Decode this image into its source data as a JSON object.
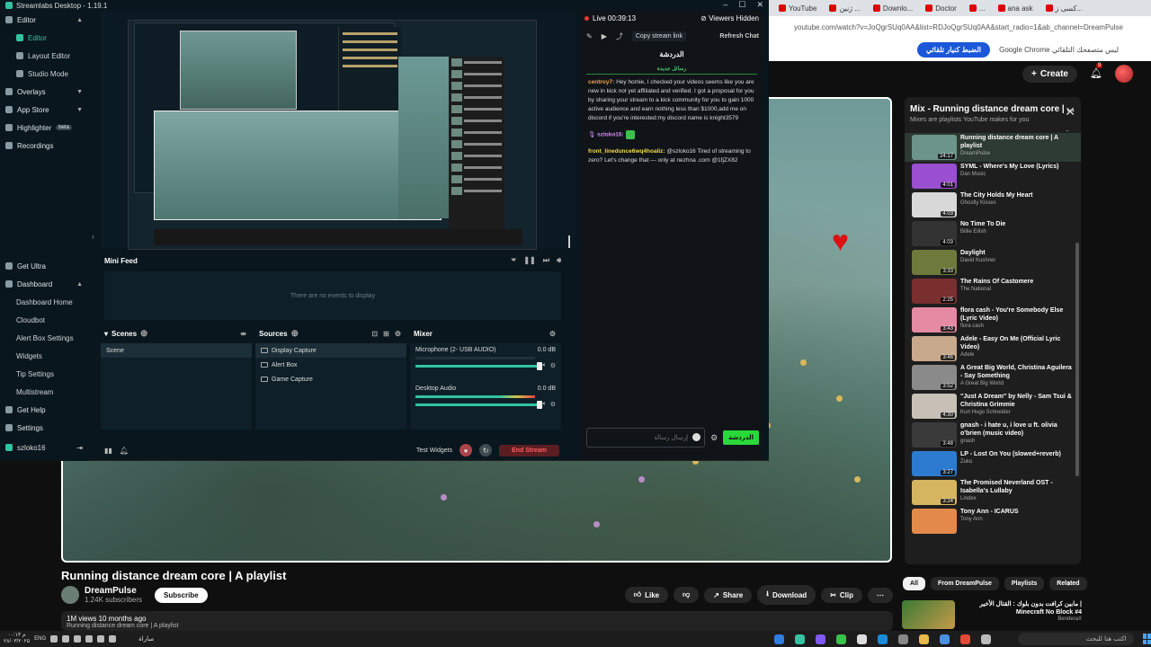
{
  "browser": {
    "tabs": [
      "YouTube",
      "ژنین ...",
      "Downlo...",
      "Doctor",
      "...",
      "ana ask",
      "کسی ز..."
    ],
    "url": "youtube.com/watch?v=JoQgrSUq0AA&list=RDJoQgrSUq0AA&start_radio=1&ab_channel=DreamPulse",
    "autoplay_label": "الضبط كنيار تلقائي",
    "bookmark_text": "Google Chrome ليس متصفحك التلقائي"
  },
  "youtube": {
    "create_label": "Create",
    "notif_count": "9",
    "video_title": "Running distance dream core | A playlist",
    "channel_name": "DreamPulse",
    "channel_subs": "1.24K subscribers",
    "subscribe_label": "Subscribe",
    "actions": {
      "like": "Like",
      "share": "Share",
      "download": "Download",
      "clip": "Clip"
    },
    "desc_line1": "1M views  10 months ago",
    "desc_line2": "Running distance dream core | A playlist",
    "playlist": {
      "title": "Mix - Running distance dream core | ...",
      "subtitle": "Mixes are playlists YouTube makes for you",
      "items": [
        {
          "title": "Running distance dream core | A playlist",
          "artist": "DreamPulse",
          "duration": "24:17",
          "color": "#6d9488"
        },
        {
          "title": "SYML - Where's My Love (Lyrics)",
          "artist": "Dan Music",
          "duration": "4:01",
          "color": "#9a4fd0"
        },
        {
          "title": "The City Holds My Heart",
          "artist": "Ghostly Kisses",
          "duration": "4:03",
          "color": "#d8d8d8"
        },
        {
          "title": "No Time To Die",
          "artist": "Billie Eilish",
          "duration": "4:03",
          "color": "#333333"
        },
        {
          "title": "Daylight",
          "artist": "David Kushner",
          "duration": "3:33",
          "color": "#6e7a3c"
        },
        {
          "title": "The Rains Of Castomere",
          "artist": "The National",
          "duration": "2:25",
          "color": "#7a2f2f"
        },
        {
          "title": "flora cash - You're Somebody Else (Lyric Video)",
          "artist": "flora cash",
          "duration": "3:43",
          "color": "#e58aa2"
        },
        {
          "title": "Adele - Easy On Me (Official Lyric Video)",
          "artist": "Adele",
          "duration": "3:46",
          "color": "#c9a98b"
        },
        {
          "title": "A Great Big World, Christina Aguilera - Say Something",
          "artist": "A Great Big World",
          "duration": "3:52",
          "color": "#8a8a8a"
        },
        {
          "title": "\"Just A Dream\" by Nelly - Sam Tsui & Christina Grimmie",
          "artist": "Kurt Hugo Schneider",
          "duration": "4:30",
          "color": "#c7c0b6"
        },
        {
          "title": "gnash - i hate u, i love u ft. olivia o'brien (music video)",
          "artist": "gnash",
          "duration": "3:48",
          "color": "#3a3a3a"
        },
        {
          "title": "LP - Lost On You (slowed+reverb)",
          "artist": "Zuko",
          "duration": "3:27",
          "color": "#2d7bd0"
        },
        {
          "title": "The Promised Neverland OST - Isabella's Lullaby",
          "artist": "Lindex",
          "duration": "3:24",
          "color": "#d6b560"
        },
        {
          "title": "Tony Ann - ICARUS",
          "artist": "Tony Ann",
          "duration": "",
          "color": "#e38a4a"
        }
      ]
    },
    "chips": [
      "All",
      "From DreamPulse",
      "Playlists",
      "Related"
    ],
    "rec_title": "مابين كرافت بدون بلوك : القتال الأخير | Minecraft No Block #4",
    "rec_channel": "BenderaX"
  },
  "streamlabs": {
    "window_title": "Streamlabs Desktop - 1.19.1",
    "sidebar": {
      "editor": "Editor",
      "editor_items": [
        "Editor",
        "Layout Editor",
        "Studio Mode"
      ],
      "overlays": "Overlays",
      "app_store": "App Store",
      "highlighter": "Highlighter",
      "beta": "beta",
      "recordings": "Recordings",
      "get_ultra": "Get Ultra",
      "dashboard": "Dashboard",
      "dashboard_items": [
        "Dashboard Home",
        "Cloudbot",
        "Alert Box Settings",
        "Widgets",
        "Tip Settings",
        "Multistream"
      ],
      "get_help": "Get Help",
      "settings": "Settings",
      "user": "szloko16"
    },
    "minifeed": {
      "title": "Mini Feed",
      "empty": "There are no events to display"
    },
    "scenes": {
      "title": "Scenes",
      "items": [
        "Scene"
      ]
    },
    "sources": {
      "title": "Sources",
      "items": [
        "Display Capture",
        "Alert Box",
        "Game Capture"
      ]
    },
    "mixer": {
      "title": "Mixer",
      "channels": [
        {
          "name": "Microphone (2- USB AUDIO)",
          "db": "0.0 dB"
        },
        {
          "name": "Desktop Audio",
          "db": "0.0 dB"
        }
      ]
    },
    "footer": {
      "test_widgets": "Test Widgets",
      "end_stream": "End Stream"
    },
    "chat": {
      "live": "Live 00:39:13",
      "viewers": "Viewers Hidden",
      "copy_link": "Copy stream link",
      "refresh": "Refresh Chat",
      "room": "الدردشة",
      "welcome": "رسائل جديدة",
      "messages": [
        {
          "user": "centroy7:",
          "text": "Hey homie, I checked your videos seems like you are new in kick not yet affiliated and verified. I got a proposal for you by sharing your stream to a kick community for you to gain 1000 active audience and earn nothing less than $1000,add me on discord if you're interested:my discord name is knight3579",
          "color": "u1"
        },
        {
          "user": "szloko16:",
          "text": "",
          "color": "u2"
        },
        {
          "user": "front_linedunce6wq4hoaliz:",
          "text": "@szloko16 Tired of streaming to zero? Let's change that — only at nezhna .com @1fjZX82",
          "color": "u3"
        }
      ],
      "input_placeholder": "إرسال رسالة",
      "send": "الدردشة"
    }
  },
  "taskbar": {
    "time": "۰۰:۱۳ م",
    "date": "۲۸/۰۳/۲۰۲۵",
    "lang": "ENG",
    "weather": "مباراة",
    "search_placeholder": "اكتب هنا للبحث"
  }
}
